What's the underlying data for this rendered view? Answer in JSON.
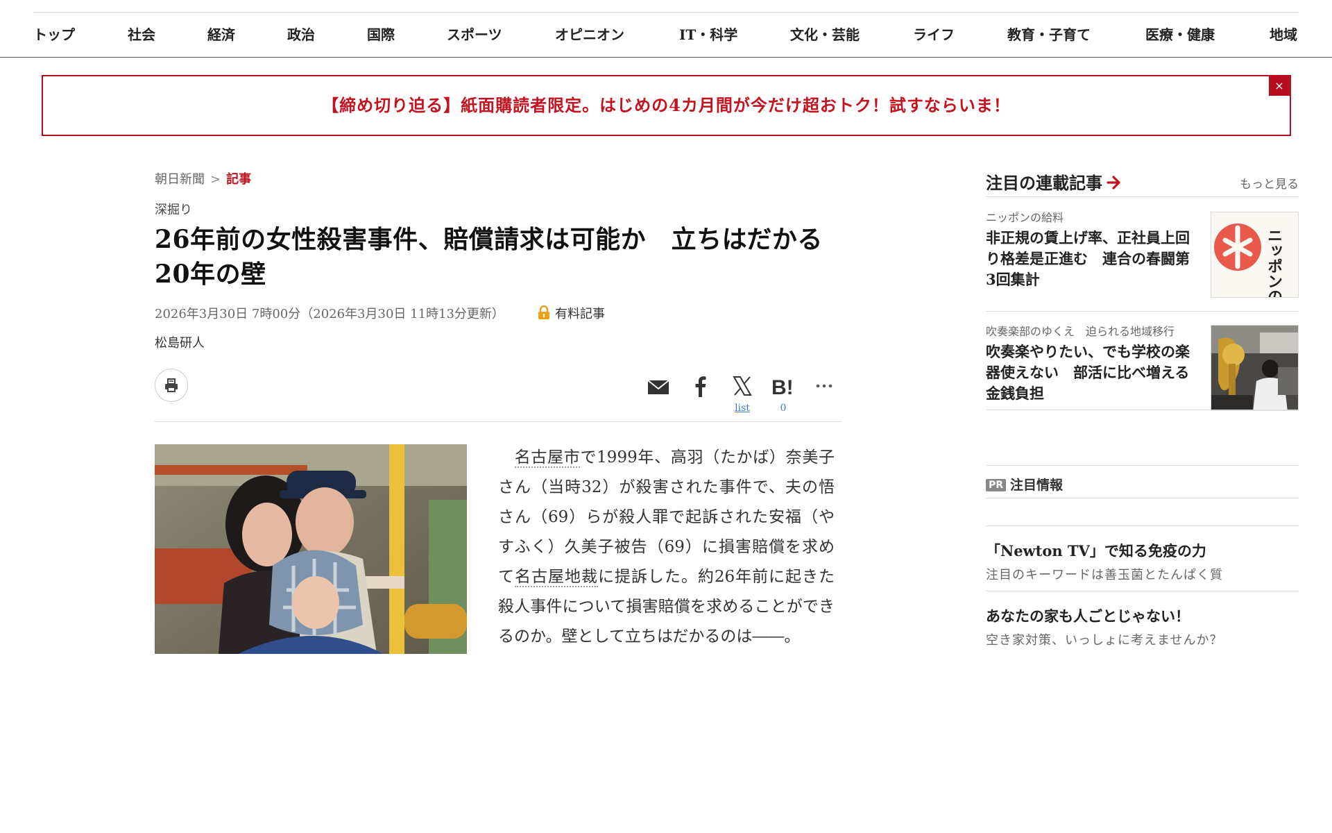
{
  "nav": {
    "items": [
      "トップ",
      "社会",
      "経済",
      "政治",
      "国際",
      "スポーツ",
      "オピニオン",
      "IT・科学",
      "文化・芸能",
      "ライフ",
      "教育・子育て",
      "医療・健康",
      "地域"
    ]
  },
  "promo": {
    "text": "【締め切り迫る】紙面購読者限定。はじめの4カ月間が今だけ超おトク！試すならいま！",
    "close": "×"
  },
  "breadcrumb": {
    "home": "朝日新聞",
    "separator": ">",
    "current": "記事"
  },
  "article": {
    "kicker": "深掘り",
    "title_line1": "26年前の女性殺害事件、賠償請求は可能か　立ちはだかる",
    "title_line2": "20年の壁",
    "dateline": "2026年3月30日 7時00分（2026年3月30日 11時13分更新）",
    "paid_label": "有料記事",
    "author": "松島研人",
    "body": {
      "indent": "　",
      "kw1": "名古屋市",
      "part1": "で1999年、高羽（たかば）奈美子さん（当時32）が殺害された事件で、夫の悟さん（69）らが殺人罪で起訴された安福（やすふく）久美子被告（69）に損害賠償を求めて",
      "kw2": "名古屋地裁",
      "part2": "に提訴した。約26年前に起きた殺人事件について損害賠償を求めることができるのか。壁として立ちはだかるのは――。"
    }
  },
  "share": {
    "x_count": "list",
    "hatena_count": "0"
  },
  "sidebar": {
    "title": "注目の連載記事",
    "more": "もっと見る",
    "series": [
      {
        "label": "ニッポンの給料",
        "title": "非正規の賃上げ率、正社員上回り格差是正進む　連合の春闘第3回集計",
        "thumb_text": "ニッポンの給料"
      },
      {
        "label": "吹奏楽部のゆくえ　迫られる地域移行",
        "title": "吹奏楽やりたい、でも学校の楽器使えない　部活に比べ増える金銭負担"
      }
    ],
    "pr": {
      "badge": "PR",
      "heading": "注目情報",
      "items": [
        {
          "title": "「Newton TV」で知る免疫の力",
          "sub": "注目のキーワードは善玉菌とたんぱく質"
        },
        {
          "title": "あなたの家も人ごとじゃない！",
          "sub": "空き家対策、いっしょに考えませんか？"
        }
      ]
    }
  },
  "colors": {
    "brand_red": "#c4121f",
    "banner_border": "#b70e1e",
    "link_blue": "#3a7cc4",
    "lock_gold": "#e8a317"
  }
}
